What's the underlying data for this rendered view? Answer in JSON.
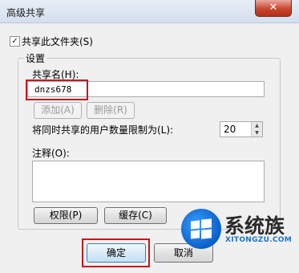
{
  "window": {
    "title": "高级共享",
    "close_label": "✕"
  },
  "share_checkbox": {
    "label": "共享此文件夹(S)",
    "checked": true
  },
  "settings_group": {
    "title": "设置",
    "share_name_label": "共享名(H):",
    "share_name_value": "dnzs678",
    "add_button": "添加(A)",
    "remove_button": "删除(R)",
    "user_limit_label": "将同时共享的用户数量限制为(L):",
    "user_limit_value": "20",
    "comment_label": "注释(O):",
    "comment_value": "",
    "permissions_button": "权限(P)",
    "cache_button": "缓存(C)"
  },
  "footer": {
    "ok_button": "确定",
    "cancel_button": "取消"
  },
  "watermark": {
    "brand": "系统族",
    "url": "XITONGZU.COM"
  },
  "colors": {
    "highlight": "#c8161d",
    "close_button": "#c8462f",
    "watermark_blue": "#1e72c8"
  }
}
